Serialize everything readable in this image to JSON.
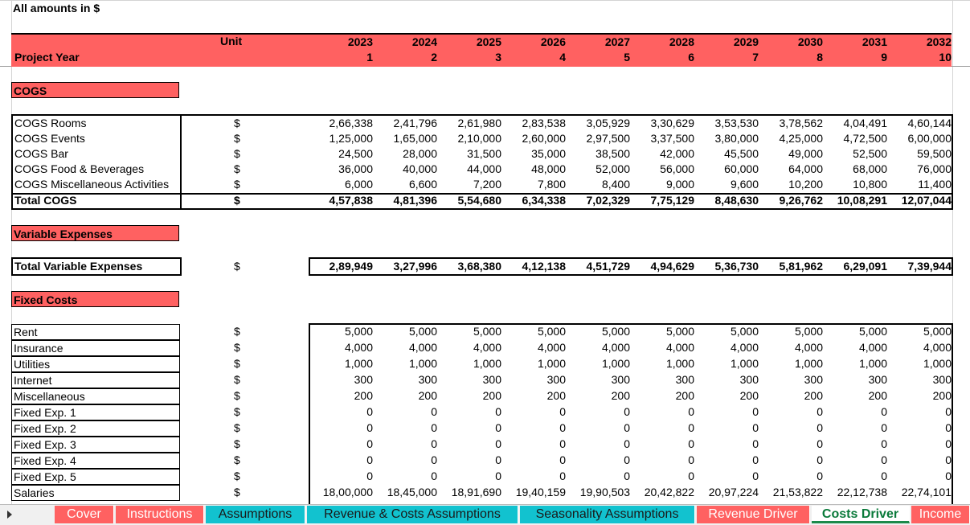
{
  "header": {
    "title": "All amounts in $"
  },
  "year_band": {
    "unit_label": "Unit",
    "project_year_label": "Project Year",
    "years": [
      "2023",
      "2024",
      "2025",
      "2026",
      "2027",
      "2028",
      "2029",
      "2030",
      "2031",
      "2032"
    ],
    "indices": [
      "1",
      "2",
      "3",
      "4",
      "5",
      "6",
      "7",
      "8",
      "9",
      "10"
    ]
  },
  "cogs": {
    "section_label": "COGS",
    "rows": [
      {
        "label": "COGS Rooms",
        "unit": "$",
        "values": [
          "2,66,338",
          "2,41,796",
          "2,61,980",
          "2,83,538",
          "3,05,929",
          "3,30,629",
          "3,53,530",
          "3,78,562",
          "4,04,491",
          "4,60,144"
        ]
      },
      {
        "label": "COGS Events",
        "unit": "$",
        "values": [
          "1,25,000",
          "1,65,000",
          "2,10,000",
          "2,60,000",
          "2,97,500",
          "3,37,500",
          "3,80,000",
          "4,25,000",
          "4,72,500",
          "6,00,000"
        ]
      },
      {
        "label": "COGS Bar",
        "unit": "$",
        "values": [
          "24,500",
          "28,000",
          "31,500",
          "35,000",
          "38,500",
          "42,000",
          "45,500",
          "49,000",
          "52,500",
          "59,500"
        ]
      },
      {
        "label": "COGS Food & Beverages",
        "unit": "$",
        "values": [
          "36,000",
          "40,000",
          "44,000",
          "48,000",
          "52,000",
          "56,000",
          "60,000",
          "64,000",
          "68,000",
          "76,000"
        ]
      },
      {
        "label": "COGS Miscellaneous Activities",
        "unit": "$",
        "values": [
          "6,000",
          "6,600",
          "7,200",
          "7,800",
          "8,400",
          "9,000",
          "9,600",
          "10,200",
          "10,800",
          "11,400"
        ]
      }
    ],
    "total": {
      "label": "Total COGS",
      "unit": "$",
      "values": [
        "4,57,838",
        "4,81,396",
        "5,54,680",
        "6,34,338",
        "7,02,329",
        "7,75,129",
        "8,48,630",
        "9,26,762",
        "10,08,291",
        "12,07,044"
      ]
    }
  },
  "variable": {
    "section_label": "Variable Expenses",
    "total": {
      "label": "Total Variable Expenses",
      "unit": "$",
      "values": [
        "2,89,949",
        "3,27,996",
        "3,68,380",
        "4,12,138",
        "4,51,729",
        "4,94,629",
        "5,36,730",
        "5,81,962",
        "6,29,091",
        "7,39,944"
      ]
    }
  },
  "fixed": {
    "section_label": "Fixed Costs",
    "rows": [
      {
        "label": "Rent",
        "unit": "$",
        "values": [
          "5,000",
          "5,000",
          "5,000",
          "5,000",
          "5,000",
          "5,000",
          "5,000",
          "5,000",
          "5,000",
          "5,000"
        ]
      },
      {
        "label": "Insurance",
        "unit": "$",
        "values": [
          "4,000",
          "4,000",
          "4,000",
          "4,000",
          "4,000",
          "4,000",
          "4,000",
          "4,000",
          "4,000",
          "4,000"
        ]
      },
      {
        "label": "Utilities",
        "unit": "$",
        "values": [
          "1,000",
          "1,000",
          "1,000",
          "1,000",
          "1,000",
          "1,000",
          "1,000",
          "1,000",
          "1,000",
          "1,000"
        ]
      },
      {
        "label": "Internet",
        "unit": "$",
        "values": [
          "300",
          "300",
          "300",
          "300",
          "300",
          "300",
          "300",
          "300",
          "300",
          "300"
        ]
      },
      {
        "label": "Miscellaneous",
        "unit": "$",
        "values": [
          "200",
          "200",
          "200",
          "200",
          "200",
          "200",
          "200",
          "200",
          "200",
          "200"
        ]
      },
      {
        "label": "Fixed Exp. 1",
        "unit": "$",
        "values": [
          "0",
          "0",
          "0",
          "0",
          "0",
          "0",
          "0",
          "0",
          "0",
          "0"
        ]
      },
      {
        "label": "Fixed Exp. 2",
        "unit": "$",
        "values": [
          "0",
          "0",
          "0",
          "0",
          "0",
          "0",
          "0",
          "0",
          "0",
          "0"
        ]
      },
      {
        "label": "Fixed Exp. 3",
        "unit": "$",
        "values": [
          "0",
          "0",
          "0",
          "0",
          "0",
          "0",
          "0",
          "0",
          "0",
          "0"
        ]
      },
      {
        "label": "Fixed Exp. 4",
        "unit": "$",
        "values": [
          "0",
          "0",
          "0",
          "0",
          "0",
          "0",
          "0",
          "0",
          "0",
          "0"
        ]
      },
      {
        "label": "Fixed Exp. 5",
        "unit": "$",
        "values": [
          "0",
          "0",
          "0",
          "0",
          "0",
          "0",
          "0",
          "0",
          "0",
          "0"
        ]
      },
      {
        "label": "Salaries",
        "unit": "$",
        "values": [
          "18,00,000",
          "18,45,000",
          "18,91,690",
          "19,40,159",
          "19,90,503",
          "20,42,822",
          "20,97,224",
          "21,53,822",
          "22,12,738",
          "22,74,101"
        ]
      }
    ]
  },
  "tabs": [
    {
      "label": "Cover",
      "style": "red"
    },
    {
      "label": "Instructions",
      "style": "red"
    },
    {
      "label": "Assumptions",
      "style": "teal"
    },
    {
      "label": "Revenue & Costs Assumptions",
      "style": "teal"
    },
    {
      "label": "Seasonality Assumptions",
      "style": "teal"
    },
    {
      "label": "Revenue Driver",
      "style": "red"
    },
    {
      "label": "Costs Driver",
      "style": "active"
    },
    {
      "label": "Income",
      "style": "red"
    }
  ],
  "colors": {
    "band": "#ff6161",
    "tab_teal": "#12c2cf",
    "active_tab_text": "#0a7a3a"
  }
}
